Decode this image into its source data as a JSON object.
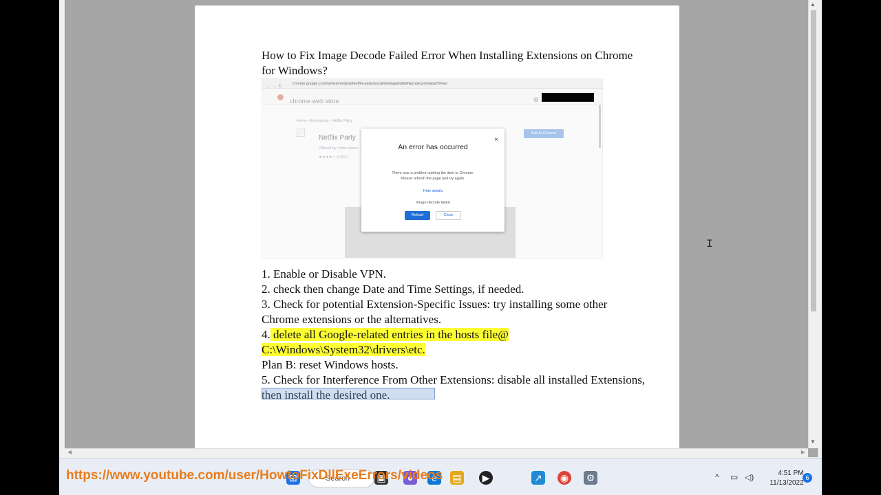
{
  "document": {
    "title": "How to Fix Image Decode Failed Error When Installing Extensions on Chrome for Windows?",
    "steps": {
      "s1": "1. Enable or Disable VPN.",
      "s2": "2. check then change Date and Time Settings, if needed.",
      "s3": "3. Check for potential Extension-Specific Issues: try installing some other Chrome extensions or the alternatives.",
      "s4_prefix": "4.",
      "s4_line1": " delete all Google-related entries in the hosts file@ ",
      "s4_line2": "C:\\Windows\\System32\\drivers\\etc",
      "s4_suffix": ".",
      "planb": "Plan B: reset Windows hosts.",
      "s5": "5. Check for Interference From Other Extensions: disable all installed Extensions, then install the desired one."
    }
  },
  "embedded_screenshot": {
    "address": "chrome.google.com/webstore/detail/netflix-party/oocalimimngaihdkbihfgmpkcpnmlaoa?hl=en",
    "store_name": "chrome web store",
    "breadcrumb": "Home  ›  Extensions  ›  Netflix Party",
    "extension_name": "Netflix Party",
    "offered_by": "Offered by: https://www...",
    "rating": "★★★★☆  3,293  |",
    "add_button": "Add to Chrome",
    "dialog": {
      "title": "An error has occurred",
      "close": "×",
      "message_line1": "There was a problem adding the item to Chrome.",
      "message_line2": "Please refresh the page and try again.",
      "hide_details": "Hide details",
      "error": "Image decode failed",
      "reload": "Reload",
      "close_button": "Close"
    }
  },
  "taskbar": {
    "channel_url": "https://www.youtube.com/user/HowtoFixDllExeErrors/videos",
    "search_placeholder": "Search",
    "clock_time": "4:51 PM",
    "clock_date": "11/13/2022",
    "notification_count": "6"
  }
}
